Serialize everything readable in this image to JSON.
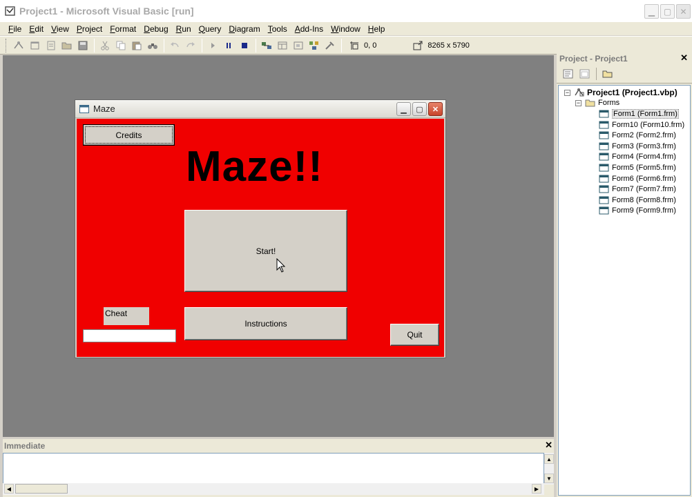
{
  "ide": {
    "title": "Project1 - Microsoft Visual Basic [run]",
    "menu": [
      "File",
      "Edit",
      "View",
      "Project",
      "Format",
      "Debug",
      "Run",
      "Query",
      "Diagram",
      "Tools",
      "Add-Ins",
      "Window",
      "Help"
    ],
    "position_readout": "0, 0",
    "size_readout": "8265 x 5790"
  },
  "maze_form": {
    "title": "Maze",
    "heading": "Maze!!",
    "credits_label": "Credits",
    "start_label": "Start!",
    "instructions_label": "Instructions",
    "quit_label": "Quit",
    "cheat_label": "Cheat",
    "cheat_value": "",
    "background_color": "#f00000"
  },
  "project_explorer": {
    "title": "Project - Project1",
    "root": "Project1 (Project1.vbp)",
    "folder": "Forms",
    "forms": [
      "Form1 (Form1.frm)",
      "Form10 (Form10.frm)",
      "Form2 (Form2.frm)",
      "Form3 (Form3.frm)",
      "Form4 (Form4.frm)",
      "Form5 (Form5.frm)",
      "Form6 (Form6.frm)",
      "Form7 (Form7.frm)",
      "Form8 (Form8.frm)",
      "Form9 (Form9.frm)"
    ],
    "selected_form": "Form1 (Form1.frm)"
  },
  "immediate": {
    "title": "Immediate"
  }
}
